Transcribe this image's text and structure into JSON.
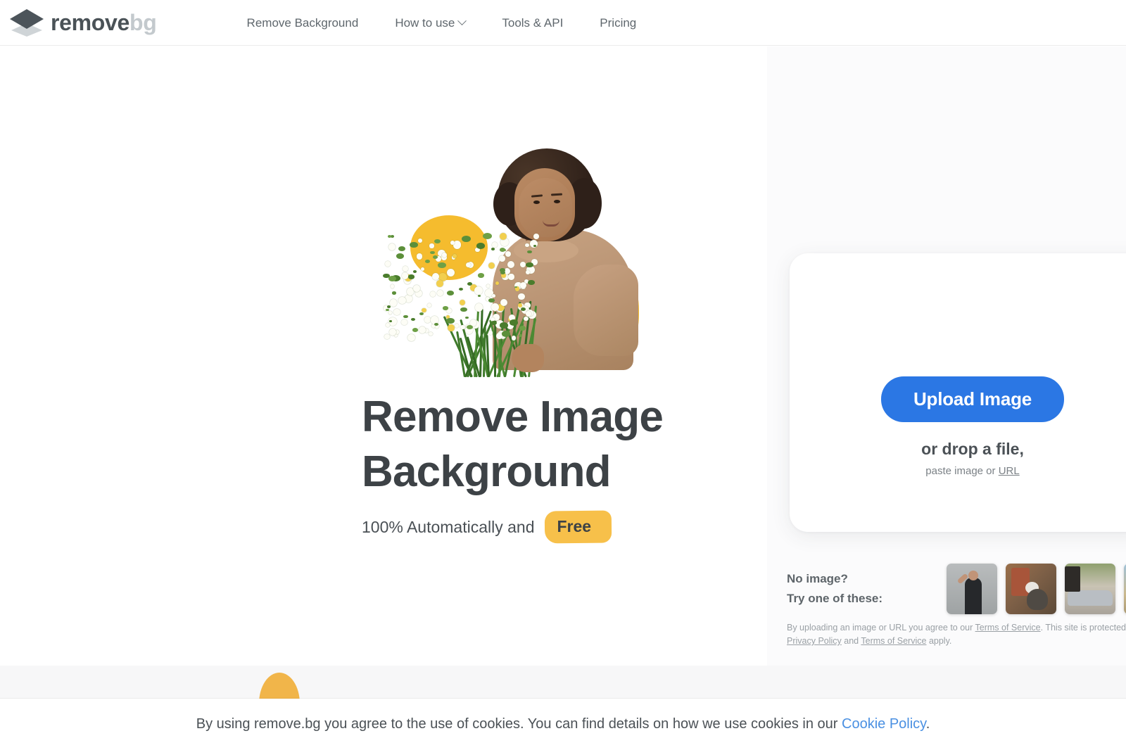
{
  "header": {
    "logo": {
      "icon": "layers-diamond-icon",
      "word_primary": "remove",
      "word_secondary": "bg"
    },
    "nav": [
      {
        "label": "Remove Background",
        "has_dropdown": false
      },
      {
        "label": "How to use",
        "has_dropdown": true
      },
      {
        "label": "Tools & API",
        "has_dropdown": false
      },
      {
        "label": "Pricing",
        "has_dropdown": false
      }
    ]
  },
  "hero": {
    "image_alt": "Woman with curly hair holding a bouquet of white daisies",
    "headline_line1": "Remove Image",
    "headline_line2": "Background",
    "sub_prefix": "100% Automatically and",
    "sub_badge": "Free"
  },
  "upload": {
    "button_label": "Upload Image",
    "drop_text": "or drop a file,",
    "paste_prefix": "paste image or",
    "paste_link": "URL"
  },
  "samples": {
    "label_line1": "No image?",
    "label_line2": "Try one of these:",
    "thumbnails": [
      {
        "name": "sample-woman-flexing"
      },
      {
        "name": "sample-cat"
      },
      {
        "name": "sample-car"
      },
      {
        "name": "sample-outdoor"
      }
    ]
  },
  "legal": {
    "part1": "By uploading an image or URL you agree to our ",
    "terms_link": "Terms of Service",
    "part2": ". This site is protected by hCaptcha and its ",
    "privacy_link": "Privacy Policy",
    "part3": " and ",
    "terms_link2": "Terms of Service",
    "part4": " apply."
  },
  "cookie": {
    "text": "By using remove.bg you agree to the use of cookies. You can find details on how we use cookies in our ",
    "link": "Cookie Policy",
    "suffix": "."
  },
  "colors": {
    "accent_blue": "#2b77e4",
    "highlight_yellow": "#f7c04a",
    "link_blue": "#4a90e2",
    "text_dark": "#3d4246",
    "text_muted": "#9aa0a5",
    "panel_bg": "#fbfbfc"
  }
}
